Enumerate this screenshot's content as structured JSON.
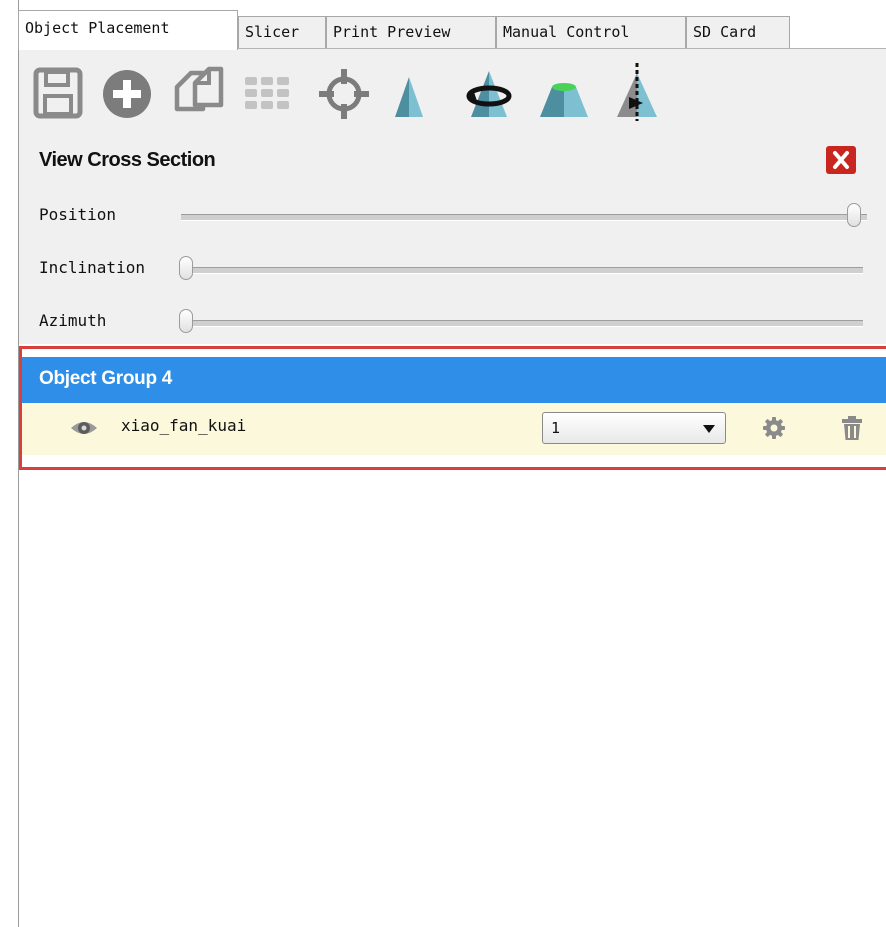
{
  "tabs": [
    {
      "label": "Object Placement",
      "active": true
    },
    {
      "label": "Slicer",
      "active": false
    },
    {
      "label": "Print Preview",
      "active": false
    },
    {
      "label": "Manual Control",
      "active": false
    },
    {
      "label": "SD Card",
      "active": false
    }
  ],
  "toolbar": {
    "icons": [
      "save-icon",
      "add-icon",
      "copy-icon",
      "grid-arrange-icon",
      "center-icon",
      "scale-icon",
      "rotate-icon",
      "lay-flat-icon",
      "cut-icon"
    ]
  },
  "cross_section": {
    "title": "View Cross Section",
    "close_icon": "close-icon",
    "sliders": {
      "position": {
        "label": "Position",
        "value": 1.0
      },
      "inclination": {
        "label": "Inclination",
        "value": 0.0
      },
      "azimuth": {
        "label": "Azimuth",
        "value": 0.0
      }
    }
  },
  "objects": {
    "group_title": "Object Group 4",
    "items": [
      {
        "name": "xiao_fan_kuai",
        "extruder": "1",
        "visible": true
      }
    ]
  },
  "colors": {
    "accent": "#2e8ee8",
    "row_background": "#fcf8dc",
    "close_button": "#c8261f",
    "highlight_border": "#d8403f",
    "model_teal": "#5ea3b6",
    "model_green": "#4ad15a"
  }
}
